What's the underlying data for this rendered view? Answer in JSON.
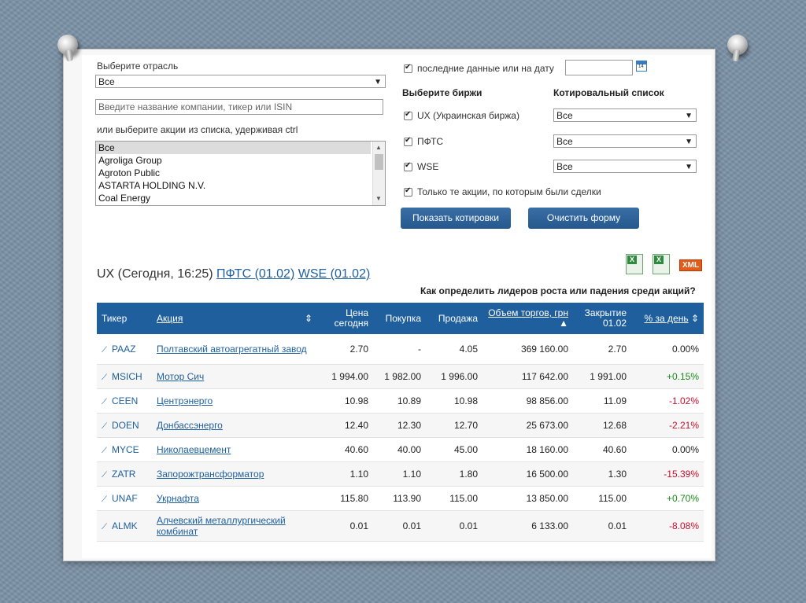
{
  "filters": {
    "industry_label": "Выберите отрасль",
    "industry_value": "Все",
    "search_placeholder": "Введите название компании, тикер или ISIN",
    "list_hint": "или выберите акции из списка, удерживая ctrl",
    "list_items": [
      "Все",
      "Agroliga Group",
      "Agroton Public",
      "ASTARTA HOLDING N.V.",
      "Coal Energy"
    ],
    "latest_label": "последние данные или на дату",
    "exchanges_label": "Выберите биржи",
    "quote_list_label": "Котировальный список",
    "exchanges": [
      {
        "name": "UX (Украинская биржа)",
        "list": "Все"
      },
      {
        "name": "ПФТС",
        "list": "Все"
      },
      {
        "name": "WSE",
        "list": "Все"
      }
    ],
    "only_traded_label": "Только те акции, по которым были сделки",
    "show_button": "Показать котировки",
    "clear_button": "Очистить форму",
    "calendar_text": "14"
  },
  "heading": {
    "ux": "UX (Сегодня, 16:25)",
    "pfts": "ПФТС (01.02)",
    "wse": "WSE (01.02)",
    "leaders_link": "Как определить лидеров роста или падения среди акций?",
    "xml_label": "XML"
  },
  "table": {
    "headers": [
      "Тикер",
      "Акция",
      "Цена сегодня",
      "Покупка",
      "Продажа",
      "Объем торгов, грн",
      "Закрытие 01.02",
      "% за день"
    ],
    "rows": [
      {
        "ticker": "PAAZ",
        "name": "Полтавский автоагрегатный завод",
        "price": "2.70",
        "bid": "-",
        "ask": "4.05",
        "volume": "369 160.00",
        "close": "2.70",
        "change": "0.00%"
      },
      {
        "ticker": "MSICH",
        "name": "Мотор Сич",
        "price": "1 994.00",
        "bid": "1 982.00",
        "ask": "1 996.00",
        "volume": "117 642.00",
        "close": "1 991.00",
        "change": "+0.15%"
      },
      {
        "ticker": "CEEN",
        "name": "Центрэнерго",
        "price": "10.98",
        "bid": "10.89",
        "ask": "10.98",
        "volume": "98 856.00",
        "close": "11.09",
        "change": "-1.02%"
      },
      {
        "ticker": "DOEN",
        "name": "Донбассэнерго",
        "price": "12.40",
        "bid": "12.30",
        "ask": "12.70",
        "volume": "25 673.00",
        "close": "12.68",
        "change": "-2.21%"
      },
      {
        "ticker": "MYCE",
        "name": "Николаевцемент",
        "price": "40.60",
        "bid": "40.00",
        "ask": "45.00",
        "volume": "18 160.00",
        "close": "40.60",
        "change": "0.00%"
      },
      {
        "ticker": "ZATR",
        "name": "Запорожтрансформатор",
        "price": "1.10",
        "bid": "1.10",
        "ask": "1.80",
        "volume": "16 500.00",
        "close": "1.30",
        "change": "-15.39%"
      },
      {
        "ticker": "UNAF",
        "name": "Укрнафта",
        "price": "115.80",
        "bid": "113.90",
        "ask": "115.00",
        "volume": "13 850.00",
        "close": "115.00",
        "change": "+0.70%"
      },
      {
        "ticker": "ALMK",
        "name": "Алчевский металлургический комбинат",
        "price": "0.01",
        "bid": "0.01",
        "ask": "0.01",
        "volume": "6 133.00",
        "close": "0.01",
        "change": "-8.08%"
      }
    ]
  },
  "colors": {
    "accent": "#1f5f9e",
    "positive": "#1a8a1a",
    "negative": "#c8102e"
  }
}
